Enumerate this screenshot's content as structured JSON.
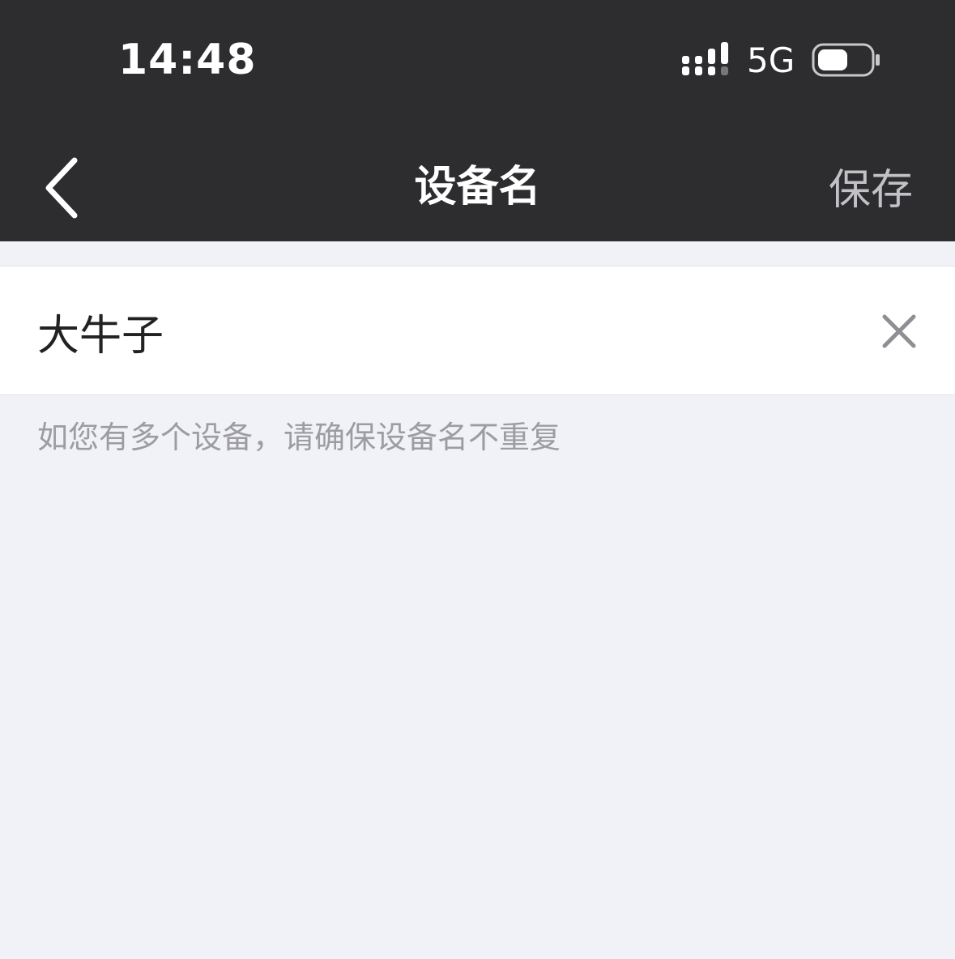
{
  "status_bar": {
    "time": "14:48",
    "network": "5G",
    "signal_icon": "signal-bars-icon",
    "battery_icon": "battery-icon",
    "battery_level": 0.55
  },
  "nav": {
    "back_icon": "chevron-left-icon",
    "title": "设备名",
    "save_label": "保存"
  },
  "device_name_field": {
    "value": "大牛子",
    "clear_icon": "close-icon"
  },
  "hint": "如您有多个设备，请确保设备名不重复",
  "colors": {
    "header_bg": "#2d2d30",
    "page_bg": "#f1f2f7",
    "input_bg": "#ffffff",
    "save_text": "#c2c2c6",
    "hint_text": "#9c9ca2"
  }
}
